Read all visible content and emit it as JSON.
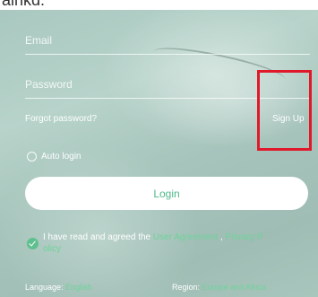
{
  "top_text": "alnkd.",
  "form": {
    "email_placeholder": "Email",
    "password_placeholder": "Password"
  },
  "links": {
    "forgot_password": "Forgot password?",
    "sign_up": "Sign Up"
  },
  "auto_login_label": "Auto login",
  "login_button": "Login",
  "agreement": {
    "prefix": "I have read and agreed the ",
    "user_agreement": "User Agreement",
    "separator": " , ",
    "privacy_part1": "Privacy P",
    "privacy_part2": "olicy"
  },
  "footer": {
    "language_label": "Language:",
    "language_value": "English",
    "region_label": "Region:",
    "region_value": "Europe and Africa"
  },
  "colors": {
    "accent_green": "#4fb88a",
    "highlight_red": "#e0192a"
  }
}
